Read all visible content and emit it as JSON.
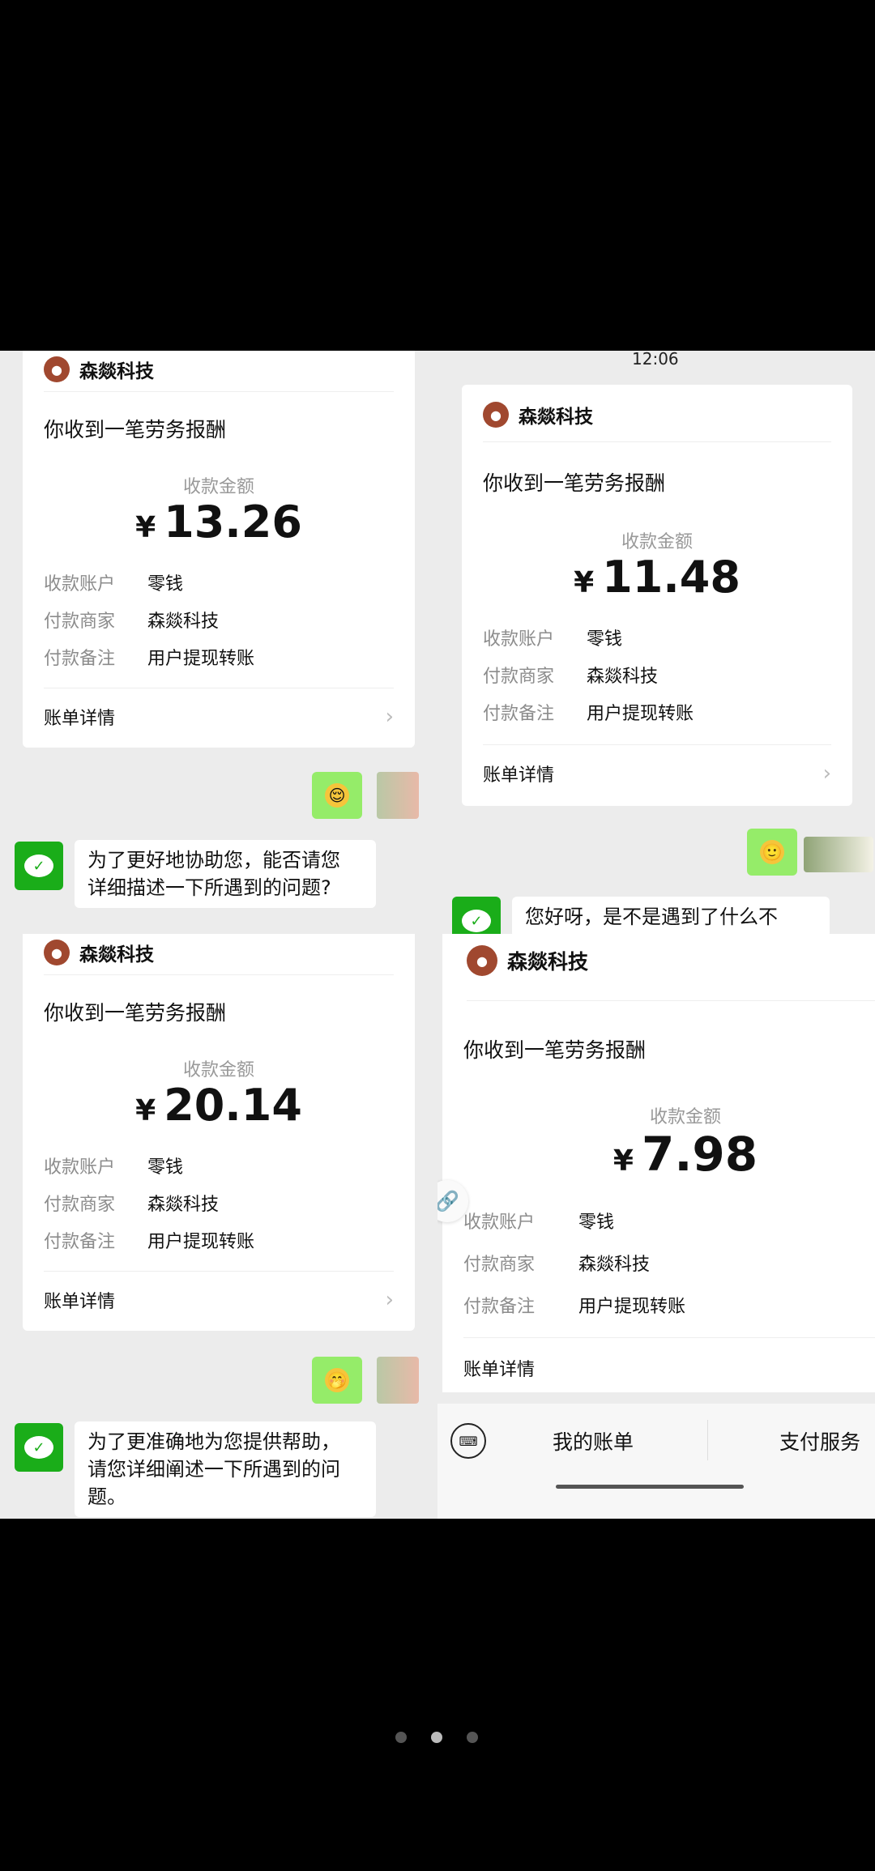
{
  "cards": [
    {
      "merchant": "森燚科技",
      "headline": "你收到一笔劳务报酬",
      "amount_label": "收款金额",
      "currency": "¥",
      "amount": "13.26",
      "rows": [
        {
          "k": "收款账户",
          "v": "零钱"
        },
        {
          "k": "付款商家",
          "v": "森燚科技"
        },
        {
          "k": "付款备注",
          "v": "用户提现转账"
        }
      ],
      "detail": "账单详情"
    },
    {
      "merchant": "森燚科技",
      "headline": "你收到一笔劳务报酬",
      "amount_label": "收款金额",
      "currency": "¥",
      "amount": "11.48",
      "rows": [
        {
          "k": "收款账户",
          "v": "零钱"
        },
        {
          "k": "付款商家",
          "v": "森燚科技"
        },
        {
          "k": "付款备注",
          "v": "用户提现转账"
        }
      ],
      "detail": "账单详情"
    },
    {
      "merchant": "森燚科技",
      "headline": "你收到一笔劳务报酬",
      "amount_label": "收款金额",
      "currency": "¥",
      "amount": "20.14",
      "rows": [
        {
          "k": "收款账户",
          "v": "零钱"
        },
        {
          "k": "付款商家",
          "v": "森燚科技"
        },
        {
          "k": "付款备注",
          "v": "用户提现转账"
        }
      ],
      "detail": "账单详情"
    },
    {
      "merchant": "森燚科技",
      "headline": "你收到一笔劳务报酬",
      "amount_label": "收款金额",
      "currency": "¥",
      "amount": "7.98",
      "rows": [
        {
          "k": "收款账户",
          "v": "零钱"
        },
        {
          "k": "付款商家",
          "v": "森燚科技"
        },
        {
          "k": "付款备注",
          "v": "用户提现转账"
        }
      ],
      "detail": "账单详情"
    }
  ],
  "messages": {
    "m1_line1": "为了更好地协助您，能否请您",
    "m1_line2": "详细描述一下所遇到的问题?",
    "m2_line1": "您好呀，是不是遇到了什么不",
    "m3_line1": "为了更准确地为您提供帮助，",
    "m3_line2": "请您详细阐述一下所遇到的问",
    "m3_line3": "题。"
  },
  "timestamp": "12:06",
  "bottom_bar": {
    "my_bill": "我的账单",
    "pay_service": "支付服务"
  },
  "pager": {
    "total": 3,
    "active_index": 1
  },
  "colors": {
    "wechat_green": "#1aad19",
    "bubble_green": "#95ec69",
    "logo": "#a0482f"
  }
}
